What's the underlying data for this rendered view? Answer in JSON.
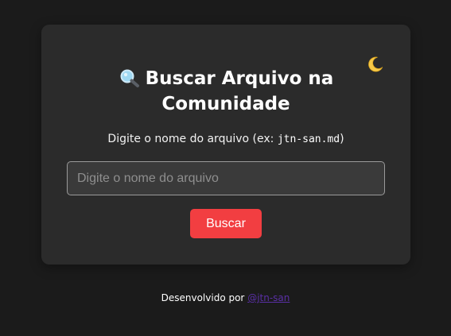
{
  "card": {
    "title_emoji": "search-icon",
    "title": "Buscar Arquivo na Comunidade",
    "subtitle_text": "Digite o nome do arquivo (ex: ",
    "subtitle_example": "jtn-san.md",
    "subtitle_end": ")",
    "input": {
      "placeholder": "Digite o nome do arquivo",
      "value": ""
    },
    "button_label": "Buscar",
    "theme_icon": "moon-icon"
  },
  "footer": {
    "prefix": "Desenvolvido por ",
    "link_text": "@jtn-san"
  },
  "colors": {
    "background": "#1b1b1b",
    "card": "#2b2b2b",
    "accent": "#f23e41",
    "link": "#5a2fa6"
  }
}
